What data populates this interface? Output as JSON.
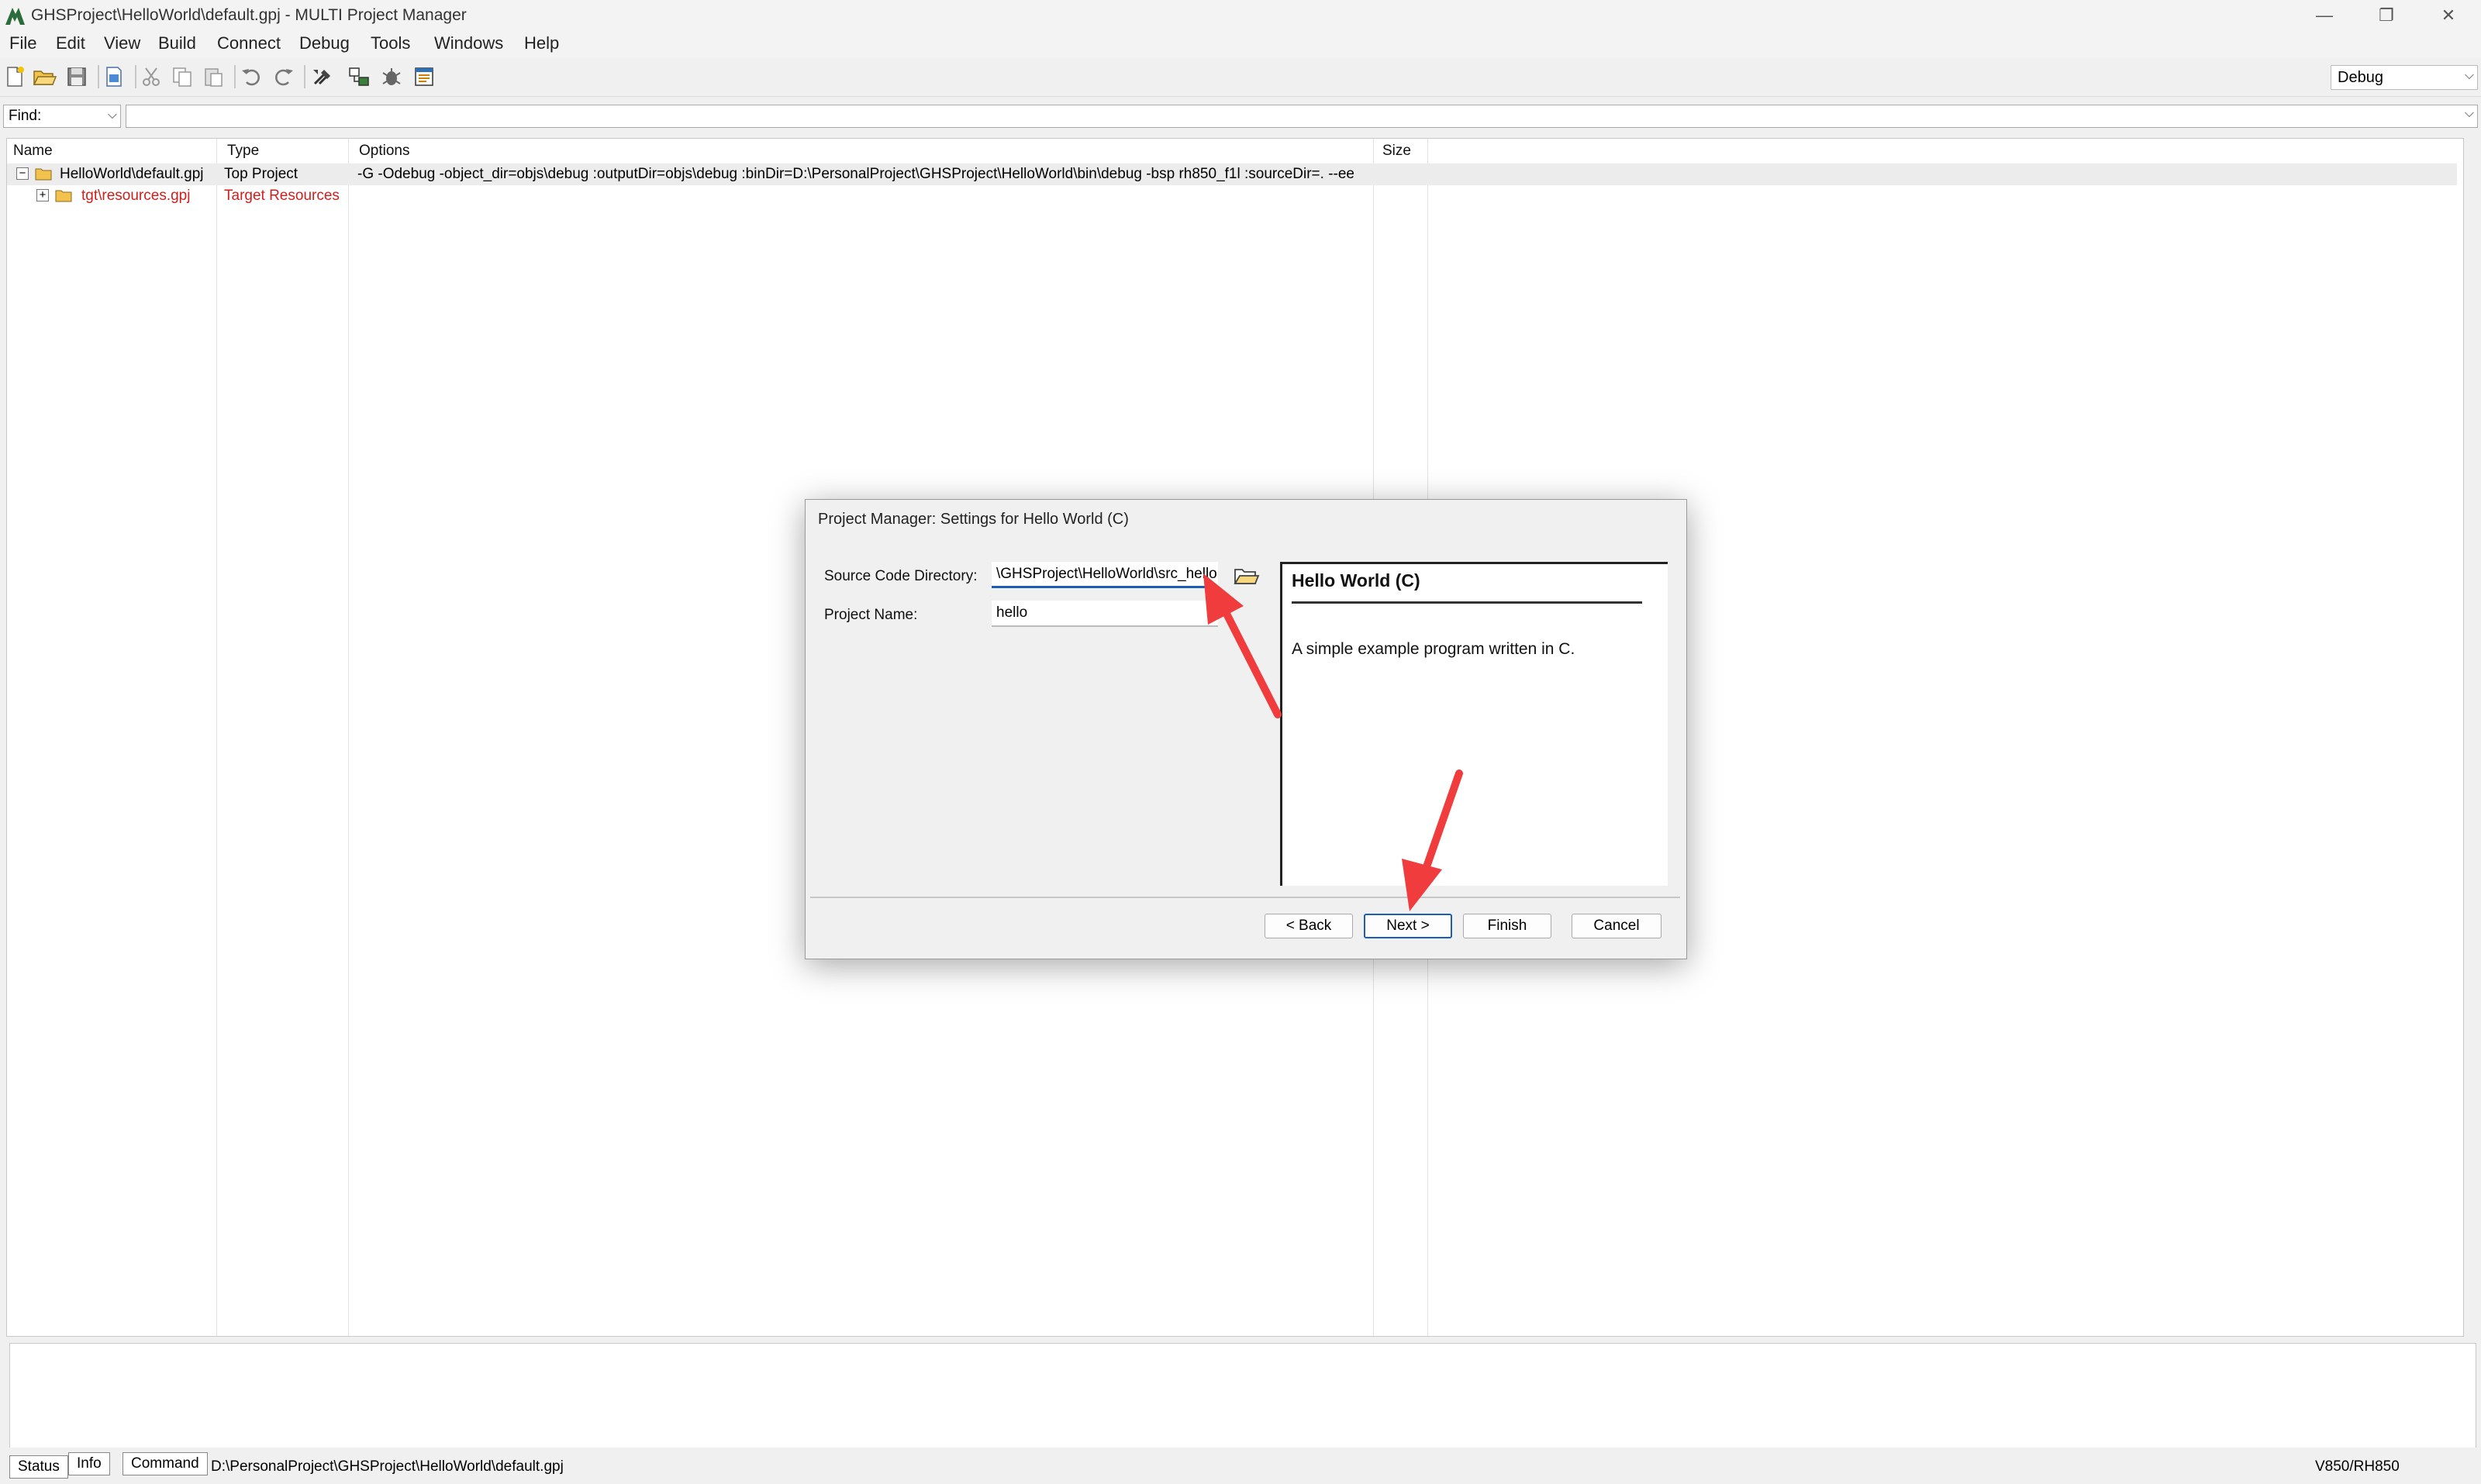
{
  "window": {
    "title": "GHSProject\\HelloWorld\\default.gpj - MULTI Project Manager",
    "minimize": "—",
    "restore": "❐",
    "close": "✕"
  },
  "menu": {
    "items": [
      "File",
      "Edit",
      "View",
      "Build",
      "Connect",
      "Debug",
      "Tools",
      "Windows",
      "Help"
    ]
  },
  "toolbar": {
    "config_value": "Debug"
  },
  "find": {
    "label": "Find:"
  },
  "tree": {
    "columns": [
      "Name",
      "Type",
      "Options",
      "Size"
    ],
    "rows": [
      {
        "expander": "−",
        "name": "HelloWorld\\default.gpj",
        "type": "Top Project",
        "options": "-G -Odebug -object_dir=objs\\debug :outputDir=objs\\debug :binDir=D:\\PersonalProject\\GHSProject\\HelloWorld\\bin\\debug -bsp rh850_f1l :sourceDir=. --ee"
      },
      {
        "expander": "+",
        "name": "tgt\\resources.gpj",
        "type": "Target Resources",
        "options": ""
      }
    ]
  },
  "status": {
    "tabs": [
      "Status",
      "Info",
      "Command"
    ],
    "path": "D:\\PersonalProject\\GHSProject\\HelloWorld\\default.gpj",
    "target": "V850/RH850"
  },
  "dialog": {
    "title": "Project Manager: Settings for Hello World (C)",
    "source_dir_label": "Source Code Directory:",
    "source_dir_value": "\\GHSProject\\HelloWorld\\src_hello",
    "project_name_label": "Project Name:",
    "project_name_value": "hello",
    "info_title": "Hello World (C)",
    "info_desc": "A simple example program written in C.",
    "back_label": "< Back",
    "next_label": "Next >",
    "finish_label": "Finish",
    "cancel_label": "Cancel"
  },
  "colors": {
    "accent": "#1a5fb4",
    "annotation_arrow": "#f03c3c",
    "target_red": "#d0201e"
  }
}
